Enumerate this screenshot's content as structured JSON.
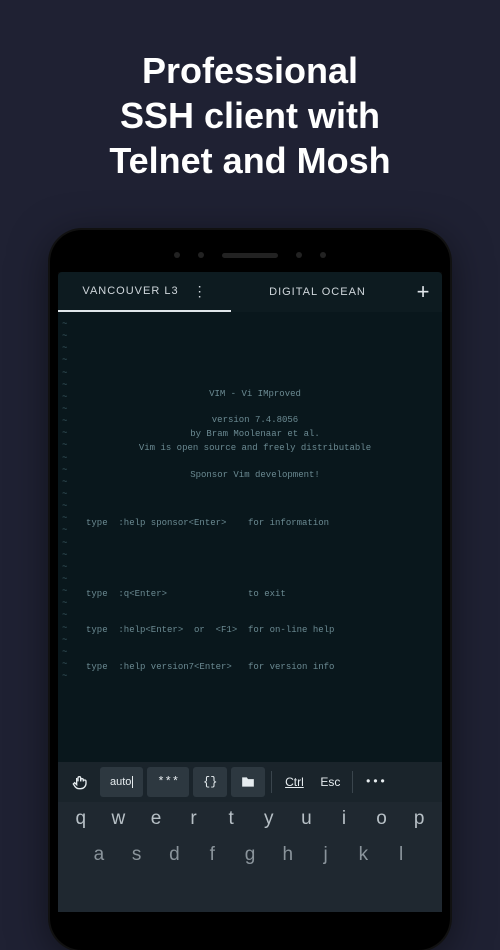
{
  "headline": {
    "line1": "Professional",
    "line2": "SSH client with",
    "line3": "Telnet and Mosh"
  },
  "tabs": {
    "active": {
      "label": "VANCOUVER L3"
    },
    "inactive": {
      "label": "DIGITAL OCEAN"
    }
  },
  "terminal": {
    "title": "VIM - Vi IMproved",
    "version": "version 7.4.8056",
    "author": "by Bram Moolenaar et al.",
    "license": "Vim is open source and freely distributable",
    "sponsor": "Sponsor Vim development!",
    "line_sponsor": "type  :help sponsor<Enter>    for information",
    "line_quit": "type  :q<Enter>               to exit",
    "line_help": "type  :help<Enter>  or  <F1>  for on-line help",
    "line_ver": "type  :help version7<Enter>   for version info"
  },
  "toolbar": {
    "auto": "auto",
    "stars": "***",
    "braces": "{}",
    "ctrl": "Ctrl",
    "esc": "Esc",
    "more": "•••"
  },
  "keyboard": {
    "row1": [
      "q",
      "w",
      "e",
      "r",
      "t",
      "y",
      "u",
      "i",
      "o",
      "p"
    ],
    "row2": [
      "a",
      "s",
      "d",
      "f",
      "g",
      "h",
      "j",
      "k",
      "l"
    ]
  }
}
